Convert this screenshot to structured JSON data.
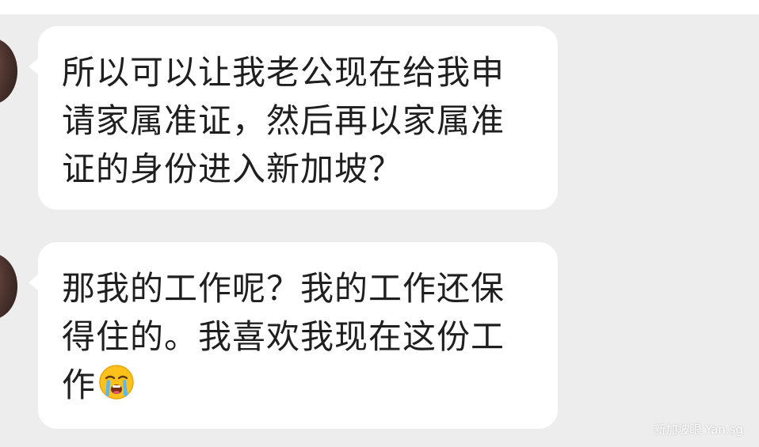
{
  "messages": [
    {
      "sender": "other",
      "text": "所以可以让我老公现在给我申请家属准证，然后再以家属准证的身份进入新加坡？"
    },
    {
      "sender": "other",
      "text": "那我的工作呢？我的工作还保得住的。我喜欢我现在这份工作",
      "emoji": "loudly-crying-face-icon"
    }
  ],
  "watermark": "新加坡眼 Yan.sg",
  "colors": {
    "background": "#ededed",
    "bubble": "#ffffff",
    "text": "#1f1f1f"
  }
}
